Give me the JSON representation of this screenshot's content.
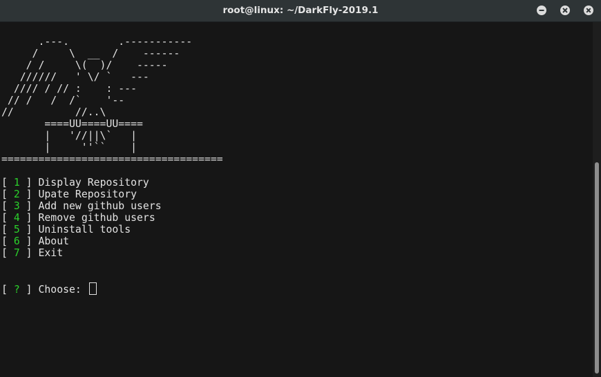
{
  "window": {
    "title": "root@linux: ~/DarkFly-2019.1",
    "controls": [
      "minimize-icon",
      "maximize-icon",
      "close-icon"
    ]
  },
  "banner": {
    "art": [
      "      .---.        .-----------",
      "     /     \\  __  /    ------",
      "    / /     \\(  )/    -----",
      "   //////   ' \\/ `   ---",
      "  //// / // :    : ---",
      " // /   /  /`    '--",
      "//          //..\\",
      "       ====UU====UU====",
      "       |   '//||\\`   |",
      "       |     ''``    |"
    ],
    "separator": "===================================="
  },
  "menu": {
    "items": [
      {
        "num": "1",
        "label": "Display Repository"
      },
      {
        "num": "2",
        "label": "Upate Repository"
      },
      {
        "num": "3",
        "label": "Add new github users"
      },
      {
        "num": "4",
        "label": "Remove github users"
      },
      {
        "num": "5",
        "label": "Uninstall tools"
      },
      {
        "num": "6",
        "label": "About"
      },
      {
        "num": "7",
        "label": "Exit"
      }
    ]
  },
  "prompt": {
    "marker": "?",
    "label": "Choose:"
  },
  "colors": {
    "background": "#161616",
    "text": "#e3e3e3",
    "accent_green": "#2bd12b",
    "titlebar": "#2e3436"
  }
}
